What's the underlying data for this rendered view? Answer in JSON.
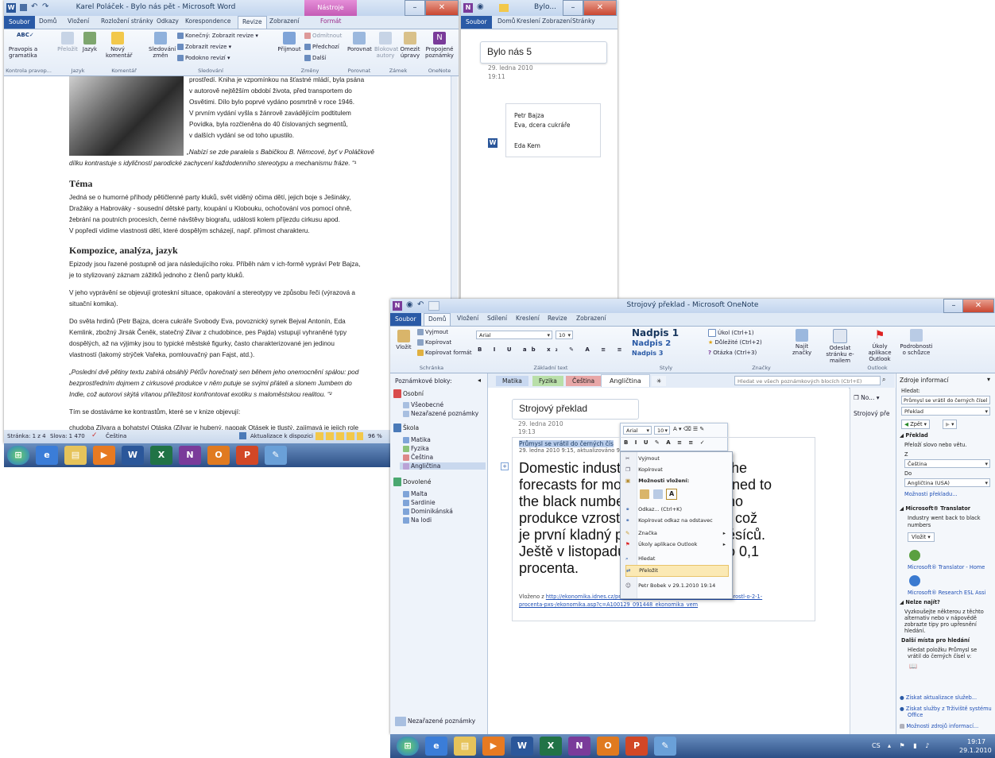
{
  "word": {
    "title": "Karel Poláček - Bylo nás pět - Microsoft Word",
    "context_tab": "Nástroje obrázku",
    "tabs": [
      "Soubor",
      "Domů",
      "Vložení",
      "Rozložení stránky",
      "Odkazy",
      "Korespondence",
      "Revize",
      "Zobrazení",
      "Formát"
    ],
    "ribbon": {
      "pravopis": "Pravopis a gramatika",
      "prelozit": "Přeložit",
      "jazyk": "Jazyk",
      "novy_komentar": "Nový komentář",
      "sledovani_zmen": "Sledování změn",
      "konecny": "Konečný: Zobrazit revize",
      "zobrazit_revize": "Zobrazit revize",
      "podokno_revizi": "Podokno revizí",
      "prijmout": "Přijmout",
      "odmitnout": "Odmítnout",
      "predchozi": "Předchozí",
      "dalsi": "Další",
      "porovnat": "Porovnat",
      "blokovat": "Blokovat autory",
      "omezit": "Omezit úpravy",
      "propojene": "Propojené poznámky",
      "groups": [
        "Kontrola pravop...",
        "Jazyk",
        "Komentář",
        "Sledování",
        "Změny",
        "Porovnat",
        "Zámek",
        "OneNote"
      ]
    },
    "doc": {
      "lines_top": [
        "prostředí. Kniha je vzpomínkou na šťastné mládí, byla psána",
        "v autorově nejtěžším období života, před transportem do",
        "Osvětimi. Dílo bylo poprvé vydáno posmrtně v roce 1946.",
        "V prvním vydání vyšla s žánrově zavádějícím podtitulem",
        "Povídka, byla rozčleněna do 40 číslovaných segmentů,",
        "v dalších vydání se od toho upustilo."
      ],
      "quote1": [
        "„Nabízí se zde paralela s Babičkou B. Němcové, byť v Poláčkově",
        "dílku kontrastuje s idyličností parodické zachycení každodenního stereotypu a mechanismu fráze. “¹"
      ],
      "h_tema": "Téma",
      "tema": [
        "Jedná se o humorné příhody pětičlenné party kluků, svět viděný očima dětí, jejich boje s Ješináky,",
        "Dražáky a Habrováky - sousední dětské party, koupání u Klobouku, ochočování vos pomocí ohně,",
        "žebrání na poutních procesích, černé návštěvy biografu, události kolem příjezdu cirkusu apod.",
        "V popředí vidíme vlastnosti dětí, které dospělým scházejí, např. přímost charakteru."
      ],
      "h_kompozice": "Kompozice, analýza, jazyk",
      "komp1": [
        "Epizody jsou řazené postupně od jara následujícího roku. Příběh nám v ich-formě vypráví Petr Bajza,",
        "je to stylizovaný záznam zážitků jednoho z členů party kluků."
      ],
      "komp2": [
        "V jeho vyprávění se objevují groteskní situace, opakování a stereotypy ve způsobu řeči (výrazová a",
        "situační komika)."
      ],
      "komp3": [
        "Do světa hrdinů (Petr Bajza, dcera cukráře Svobody Eva, povoznický synek Bejval Antonín, Eda",
        "Kemlink, zbožný Jirsák Čeněk, statečný Zilvar z chudobince, pes Pajda) vstupují vyhraněné typy",
        "dospělých, až na výjimky jsou to typické městské figurky, často charakterizované jen jedinou",
        "vlastností (lakomý strýček Vařeka, pomlouvačný pan Fajst, atd.)."
      ],
      "quote2": [
        "„Poslední dvě pětiny textu zabírá obsáhlý Péťův horečnatý sen během jeho onemocnění spálou: pod",
        "bezprostředním dojmem z cirkusové produkce v něm putuje se svými přáteli a slonem Jumbem do",
        "Indie, což autorovi skýtá vítanou příležitost konfrontovat exotiku s maloměstskou realitou. “²"
      ],
      "komp4": "Tím se dostáváme ke kontrastům, které se v knize objevují:",
      "komp5": "chudoba Zilvara a bohatství Otáska (Zilvar je hubený, naopak Otásek je tlustý, zajímavá je jejich role"
    },
    "status": {
      "page": "Stránka: 1 z 4",
      "words": "Slova: 1 470",
      "lang": "Čeština",
      "update": "Aktualizace k dispozici",
      "zoom": "96 %"
    }
  },
  "onenote_small": {
    "title": "Bylo...",
    "tabs": [
      "Soubor",
      "Domů",
      "Kreslení",
      "Zobrazení",
      "Stránky"
    ],
    "page_title": "Bylo nás 5",
    "date": "29. ledna 2010",
    "time": "19:11",
    "items": [
      "Petr Bajza",
      "Eva, dcera cukráře",
      "Eda Kem"
    ]
  },
  "onenote": {
    "title": "Strojový překlad - Microsoft OneNote",
    "tabs": [
      "Soubor",
      "Domů",
      "Vložení",
      "Sdílení",
      "Kreslení",
      "Revize",
      "Zobrazení"
    ],
    "ribbon": {
      "vlozit": "Vložit",
      "vyjmout": "Vyjmout",
      "kopirovat": "Kopírovat",
      "kopirovat_format": "Kopírovat formát",
      "schranka": "Schránka",
      "font": "Arial",
      "size": "10",
      "zakladni_text": "Základní text",
      "nadpis1": "Nadpis 1",
      "nadpis2": "Nadpis 2",
      "nadpis3": "Nadpis 3",
      "styly": "Styly",
      "ukol": "Úkol (Ctrl+1)",
      "dulezite": "Důležité (Ctrl+2)",
      "otazka": "Otázka (Ctrl+3)",
      "znacky": "Značky",
      "najit": "Najít značky",
      "odeslat": "Odeslat stránku e-mailem",
      "ukoly": "Úkoly aplikace Outlook",
      "podrobnosti": "Podrobnosti o schůzce",
      "outlook": "Outlook"
    },
    "notebooks_label": "Poznámkové bloky:",
    "notebooks": [
      {
        "name": "Osobní",
        "sections": [
          "Všeobecné",
          "Nezařazené poznámky"
        ]
      },
      {
        "name": "Škola",
        "sections": [
          "Matika",
          "Fyzika",
          "Čeština",
          "Angličtina"
        ]
      },
      {
        "name": "Dovolené",
        "sections": [
          "Malta",
          "Sardinie",
          "Dominikánská",
          "Na lodi"
        ]
      }
    ],
    "unfiled": "Nezařazené poznámky",
    "section_tabs": [
      "Matika",
      "Fyzika",
      "Čeština",
      "Angličtina"
    ],
    "search_placeholder": "Hledat ve všech poznámkových blocích (Ctrl+E)",
    "new_page": "No...",
    "page_list": [
      "Strojový pře"
    ],
    "page_title": "Strojový překlad",
    "date": "29. ledna 2010",
    "time": "19:13",
    "selected_line": "Průmysl se vrátil do černých čís",
    "meta_line": "29. ledna 2010 9:15, aktualizováno 9",
    "body_lines": [
      [
        "Domestic indust",
        "the"
      ],
      [
        "forecasts for mo",
        "rned to"
      ],
      [
        "the black numbe",
        "ho"
      ],
      [
        "produkce vzrostl",
        ", což"
      ],
      [
        "je první kladný p",
        "ěsíců."
      ],
      [
        "Ještě v listopadu",
        "o 0,1"
      ],
      [
        "procenta.",
        ""
      ]
    ],
    "inserted_label": "Vloženo z",
    "link1": "http://ekonomika.idnes.cz/prumysl-se-vratil-do-cernych-cisel-v-prosinci-rostl-o-2-1-",
    "link2": "procenta-pxs-/ekonomika.asp?c=A100129_091448_ekonomika_vem",
    "minitoolbar": {
      "font": "Arial",
      "size": "10"
    },
    "context_menu": [
      "Vyjmout",
      "Kopírovat",
      "Možnosti vložení:",
      "Odkaz... (Ctrl+K)",
      "Kopírovat odkaz na odstavec",
      "Značka",
      "Úkoly aplikace Outlook",
      "Hledat",
      "Přeložit",
      "Petr Bobek v 29.1.2010 19:14"
    ],
    "research": {
      "title": "Zdroje informací",
      "search_label": "Hledat:",
      "search_value": "Průmysl se vrátil do černých čísel",
      "service": "Překlad",
      "back": "Zpět",
      "prelad_header": "Překlad",
      "prelad_desc": "Přeloží slovo nebo větu.",
      "z_label": "Z",
      "z_value": "Čeština",
      "do_label": "Do",
      "do_value": "Angličtina (USA)",
      "moznosti": "Možnosti překladu...",
      "translator": "Microsoft® Translator",
      "translation": [
        "Industry went back to black",
        "numbers"
      ],
      "vlozit": "Vložit",
      "translator_link": "Microsoft® Translator - Home",
      "research_link": "Microsoft® Research ESL Assi",
      "nenasli": "Nelze najít?",
      "nenasli_text": [
        "Vyzkoušejte některou z těchto",
        "alternativ nebo v nápovědě",
        "zobrazte tipy pro upřesnění",
        "hledání."
      ],
      "dalsi": "Další místa pro hledání",
      "hledat_polozku": [
        "Hledat položku Průmysl se",
        "vrátil do černých čísel v:"
      ],
      "aktualizace": "Získat aktualizace služeb...",
      "sluzby": [
        "Získat služby z Trživiště systému",
        "Office"
      ],
      "moznosti_zdroju": "Možnosti zdrojů informací..."
    }
  },
  "taskbar2": {
    "lang": "CS",
    "time": "19:17",
    "date": "29.1.2010"
  },
  "colors": {
    "titlebar": "#c8d8ee",
    "file_tab": "#2a5aa6",
    "taskbar": "#2c4f86",
    "tab_matika": "#c8d8f0",
    "tab_fyzika": "#b9dfa9",
    "tab_cestina": "#e8a7a7",
    "tab_anglictina": "#d8c8e6"
  }
}
